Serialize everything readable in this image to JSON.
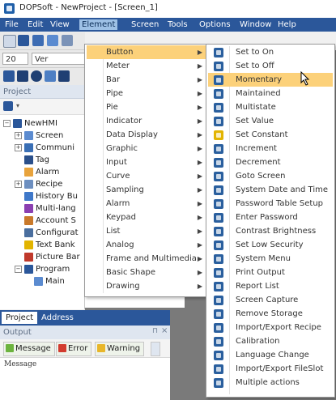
{
  "window": {
    "title": "DOPSoft - NewProject - [Screen_1]"
  },
  "menubar": {
    "items": [
      "File",
      "Edit",
      "View",
      "Element",
      "Screen",
      "Tools",
      "Options",
      "Window",
      "Help"
    ],
    "active": "Element"
  },
  "toolbar": {
    "font_size": "20",
    "font_name": "Ver"
  },
  "project_panel": {
    "header": "Project",
    "tree": [
      {
        "label": "NewHMI",
        "icon": "computer-icon"
      },
      {
        "label": "Screen",
        "icon": "screen-icon"
      },
      {
        "label": "Communi",
        "icon": "communication-icon"
      },
      {
        "label": "Tag",
        "icon": "tag-icon"
      },
      {
        "label": "Alarm",
        "icon": "alarm-icon"
      },
      {
        "label": "Recipe",
        "icon": "recipe-icon"
      },
      {
        "label": "History Bu",
        "icon": "history-icon"
      },
      {
        "label": "Multi-lang",
        "icon": "language-icon"
      },
      {
        "label": "Account S",
        "icon": "account-icon"
      },
      {
        "label": "Configurat",
        "icon": "config-icon"
      },
      {
        "label": "Text Bank",
        "icon": "textbank-icon"
      },
      {
        "label": "Picture Bar",
        "icon": "picture-icon"
      },
      {
        "label": "Program",
        "icon": "program-icon"
      },
      {
        "label": "Main",
        "icon": "main-program-icon"
      }
    ]
  },
  "bottom_tabs": [
    "Project",
    "Address"
  ],
  "output": {
    "header": "Output",
    "buttons": [
      "Message",
      "Error",
      "Warning"
    ],
    "column": "Message"
  },
  "element_menu": {
    "items": [
      "Button",
      "Meter",
      "Bar",
      "Pipe",
      "Pie",
      "Indicator",
      "Data Display",
      "Graphic",
      "Input",
      "Curve",
      "Sampling",
      "Alarm",
      "Keypad",
      "List",
      "Analog",
      "Frame and Multimedia",
      "Basic Shape",
      "Drawing"
    ],
    "highlighted": "Button"
  },
  "button_submenu": {
    "items": [
      {
        "label": "Set to On",
        "color": "#2a5f9e"
      },
      {
        "label": "Set to Off",
        "color": "#2a5f9e"
      },
      {
        "label": "Momentary",
        "color": "#2a5f9e"
      },
      {
        "label": "Maintained",
        "color": "#2a5f9e"
      },
      {
        "label": "Multistate",
        "color": "#2a5f9e"
      },
      {
        "label": "Set Value",
        "color": "#2a5f9e"
      },
      {
        "label": "Set Constant",
        "color": "#e2b400"
      },
      {
        "label": "Increment",
        "color": "#2a5f9e"
      },
      {
        "label": "Decrement",
        "color": "#2a5f9e"
      },
      {
        "label": "Goto Screen",
        "color": "#2a5f9e"
      },
      {
        "label": "System Date and Time",
        "color": "#2a5f9e"
      },
      {
        "label": "Password Table Setup",
        "color": "#2a5f9e"
      },
      {
        "label": "Enter Password",
        "color": "#2a5f9e"
      },
      {
        "label": "Contrast Brightness",
        "color": "#2a5f9e"
      },
      {
        "label": "Set Low Security",
        "color": "#2a5f9e"
      },
      {
        "label": "System Menu",
        "color": "#2a5f9e"
      },
      {
        "label": "Print Output",
        "color": "#2a5f9e"
      },
      {
        "label": "Report List",
        "color": "#2a5f9e"
      },
      {
        "label": "Screen Capture",
        "color": "#2a5f9e"
      },
      {
        "label": "Remove Storage",
        "color": "#2a5f9e"
      },
      {
        "label": "Import/Export Recipe",
        "color": "#2a5f9e"
      },
      {
        "label": "Calibration",
        "color": "#2a5f9e"
      },
      {
        "label": "Language Change",
        "color": "#2a5f9e"
      },
      {
        "label": "Import/Export FileSlot",
        "color": "#2a5f9e"
      },
      {
        "label": "Multiple actions",
        "color": "#2a5f9e"
      }
    ],
    "highlighted": "Momentary"
  },
  "colors": {
    "menubar": "#2b579a",
    "highlight": "#fcd17a",
    "panel_header": "#dfe6f0"
  }
}
